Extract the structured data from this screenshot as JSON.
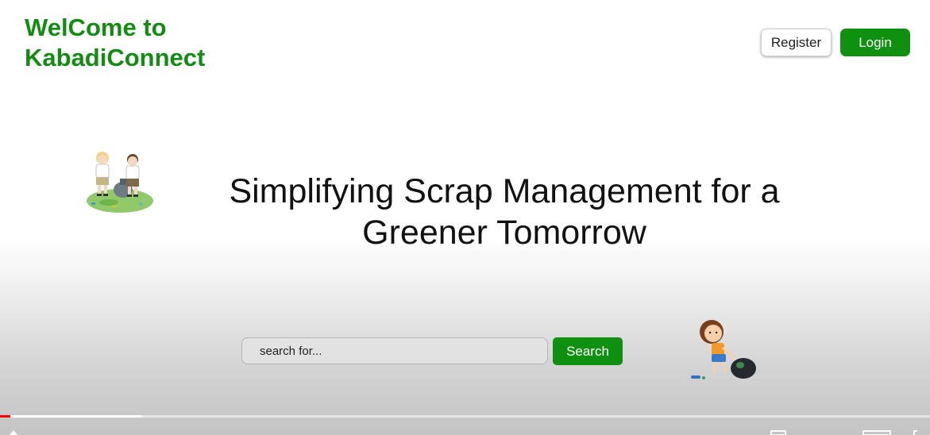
{
  "header": {
    "brand_line1": "WelCome to",
    "brand_line2": "KabadiConnect",
    "register_label": "Register",
    "login_label": "Login"
  },
  "hero": {
    "headline": "Simplifying Scrap Management for a Greener Tomorrow",
    "image_icon": "kids-recycling-illustration"
  },
  "search": {
    "placeholder": "search for...",
    "button_label": "Search"
  },
  "decor": {
    "girl_icon": "girl-collecting-trash-illustration"
  },
  "video_player": {
    "played_fraction": 0.011,
    "buffered_fraction": 0.153,
    "progress_color": "#ff0000"
  },
  "colors": {
    "brand_green": "#148c14",
    "button_green": "#109010"
  }
}
